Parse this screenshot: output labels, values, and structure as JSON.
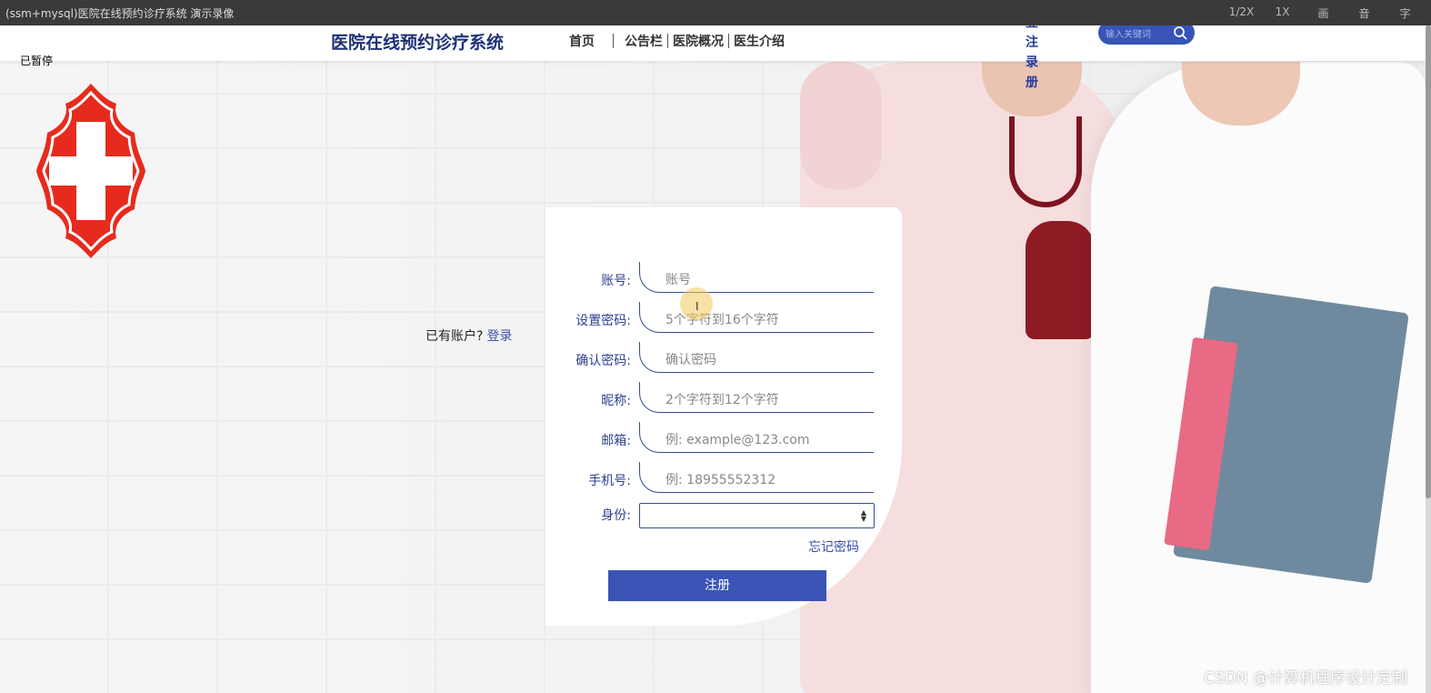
{
  "player": {
    "title": "(ssm+mysql)医院在线预约诊疗系统 演示录像",
    "controls": [
      "1/2X",
      "1X",
      "画",
      "音",
      "字"
    ]
  },
  "header": {
    "site_title": "医院在线预约诊疗系统",
    "nav": [
      "首页",
      "公告栏",
      "医院概况",
      "医生介绍"
    ],
    "auth": {
      "login": "登录",
      "register": "注册"
    },
    "search_placeholder": "输入关键词"
  },
  "paused_label": "已暂停",
  "left": {
    "have_account": "已有账户?",
    "login_link": "登录"
  },
  "form": {
    "fields": [
      {
        "label": "账号:",
        "placeholder": "账号"
      },
      {
        "label": "设置密码:",
        "placeholder": "5个字符到16个字符"
      },
      {
        "label": "确认密码:",
        "placeholder": "确认密码"
      },
      {
        "label": "昵称:",
        "placeholder": "2个字符到12个字符"
      },
      {
        "label": "邮箱:",
        "placeholder": "例: example@123.com"
      },
      {
        "label": "手机号:",
        "placeholder": "例: 18955552312"
      }
    ],
    "role_label": "身份:",
    "role_value": "",
    "forgot": "忘记密码",
    "submit": "注册"
  },
  "watermark": "CSDN @计算机程序设计定制",
  "colors": {
    "brand": "#3a54b5",
    "title": "#1e3176",
    "logo_red": "#e62b1e"
  }
}
